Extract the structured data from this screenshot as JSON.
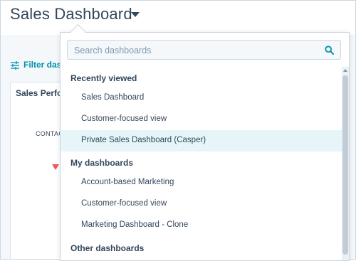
{
  "header": {
    "title": "Sales Dashboard"
  },
  "filter": {
    "label": "Filter dash"
  },
  "card": {
    "title": "Sales Perfor",
    "metric_label": "CONTAC"
  },
  "dropdown": {
    "search_placeholder": "Search dashboards",
    "sections": [
      {
        "title": "Recently viewed",
        "items": [
          "Sales Dashboard",
          "Customer-focused view",
          "Private Sales Dashboard (Casper)"
        ]
      },
      {
        "title": "My dashboards",
        "items": [
          "Account-based Marketing",
          "Customer-focused view",
          "Marketing Dashboard - Clone"
        ]
      },
      {
        "title": "Other dashboards",
        "items": []
      }
    ],
    "selected_item": "Private Sales Dashboard (Casper)"
  },
  "colors": {
    "accent": "#0091ae",
    "text": "#33475b",
    "selected_bg": "#e5f5f8",
    "negative": "#f2545b"
  },
  "icons": {
    "title_caret": "chevron-down-icon",
    "filter": "sliders-icon",
    "search": "search-icon",
    "trend": "down-triangle-icon"
  }
}
